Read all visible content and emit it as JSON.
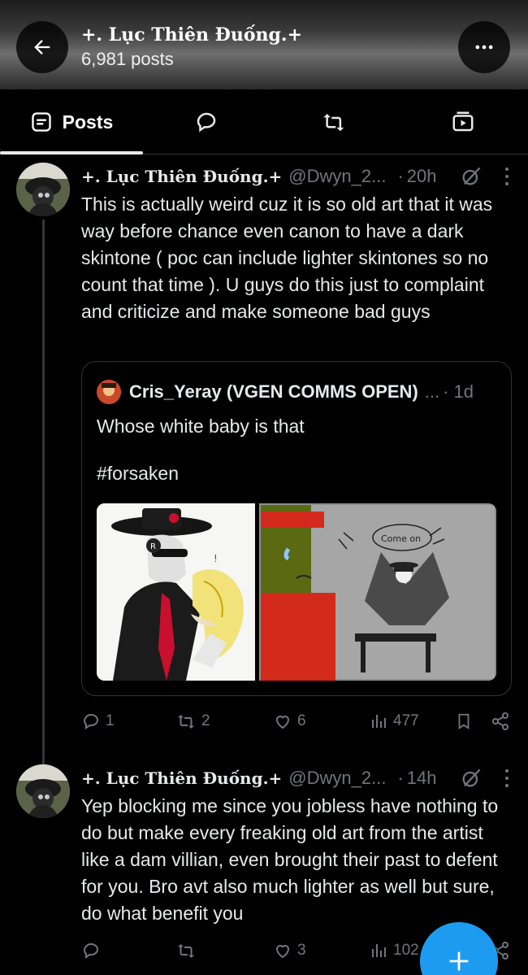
{
  "profile": {
    "name": "+. Lục Thiên Đuống.+",
    "post_count": "6,981 posts"
  },
  "tabs": [
    {
      "label": "Posts",
      "icon": "posts-icon",
      "selected": true
    },
    {
      "label": "",
      "icon": "replies-bubble-icon"
    },
    {
      "label": "",
      "icon": "repost-icon"
    },
    {
      "label": "",
      "icon": "media-video-icon"
    }
  ],
  "tweets": [
    {
      "name": "+. Lục Thiên Đuống.+",
      "handle": "@Dwyn_2...",
      "time": "20h",
      "text": "This is actually weird cuz it is so old art that it was way before chance even canon to have a dark skintone ( poc can include lighter skintones so no count that time ). U guys do this just to complaint and criticize and make someone bad guys",
      "quote": {
        "name": "Cris_Yeray (VGEN COMMS OPEN)",
        "more": "...",
        "time": "· 1d",
        "text": "Whose white baby is that",
        "hashtag": "#forsaken",
        "image_label": "Come on"
      },
      "stats": {
        "replies": "1",
        "reposts": "2",
        "likes": "6",
        "views": "477"
      }
    },
    {
      "name": "+. Lục Thiên Đuống.+",
      "handle": "@Dwyn_2...",
      "time": "14h",
      "text": "Yep blocking me since you jobless have nothing to do but make every freaking old art from the artist like a dam villian, even brought their past to defent for you. Bro avt also much lighter as well but sure, do what benefit you",
      "stats": {
        "replies": "",
        "reposts": "",
        "likes": "3",
        "views": "102"
      }
    }
  ],
  "colors": {
    "accent": "#1d9bf0",
    "muted": "#71767b",
    "text": "#e7e9ea",
    "bg": "#000000"
  }
}
